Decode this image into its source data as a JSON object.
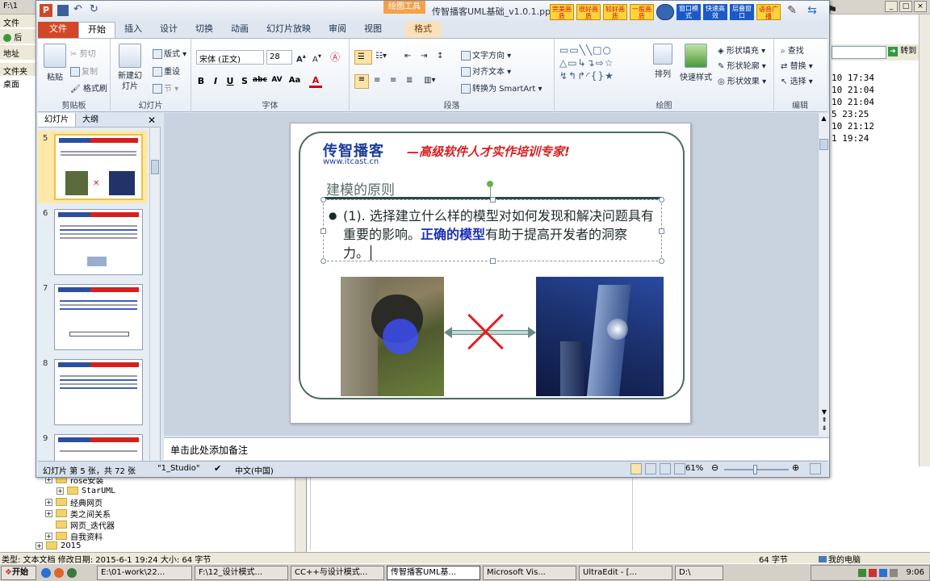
{
  "explorer": {
    "title_fragment": "F:\\1",
    "menu_file": "文件",
    "back": "后",
    "address_label": "地址",
    "folders_label": "文件夹",
    "desktop": "桌面",
    "go_label": "转到",
    "times": [
      "10 17:34",
      "10 21:04",
      "10 21:04",
      "5 23:25",
      "10 21:12",
      "1 19:24"
    ],
    "tree": [
      {
        "label": "rose安装",
        "indent": 2
      },
      {
        "label": "StarUML",
        "indent": 2
      },
      {
        "label": "经典网页",
        "indent": 1
      },
      {
        "label": "类之间关系",
        "indent": 1
      },
      {
        "label": "网页_迭代器",
        "indent": 1
      },
      {
        "label": "自我资料",
        "indent": 1
      },
      {
        "label": "2015",
        "indent": 0
      }
    ],
    "status_left": "类型: 文本文档 修改日期: 2015-6-1 19:24 大小: 64 字节",
    "status_mid": "64 字节",
    "status_right": "我的电脑"
  },
  "taskbar": {
    "start": "开始",
    "tasks": [
      "E:\\01-work\\22...",
      "F:\\12_设计模式...",
      "CC++与设计模式...",
      "传智播客UML基...",
      "Microsoft Vis...",
      "UltraEdit - [...",
      "D:\\"
    ],
    "active_index": 3,
    "clock": "9:06"
  },
  "ppt": {
    "title": "传智播客UML基础_v1.0.1.pp",
    "context_tool": "绘图工具",
    "context_tab": "格式",
    "qat_buttons": [
      "完美画质",
      "很好画质",
      "较好画质",
      "一般画质",
      "窗口模式",
      "快速高效",
      "层叠窗口",
      "语音广播"
    ],
    "tabs": [
      "文件",
      "开始",
      "插入",
      "设计",
      "切换",
      "动画",
      "幻灯片放映",
      "审阅",
      "视图"
    ],
    "selected_tab": "开始",
    "ribbon": {
      "clipboard": {
        "label": "剪贴板",
        "paste": "粘贴",
        "cut": "剪切",
        "copy": "复制",
        "format_painter": "格式刷"
      },
      "slides": {
        "label": "幻灯片",
        "new_slide": "新建幻灯片",
        "layout": "版式",
        "reset": "重设",
        "section": "节"
      },
      "font": {
        "label": "字体",
        "font_name": "宋体 (正文)",
        "font_size": "28"
      },
      "paragraph": {
        "label": "段落",
        "text_direction": "文字方向",
        "align_text": "对齐文本",
        "smartart": "转换为 SmartArt"
      },
      "drawing": {
        "label": "绘图",
        "arrange": "排列",
        "quick_styles": "快速样式",
        "shape_fill": "形状填充",
        "shape_outline": "形状轮廓",
        "shape_effects": "形状效果"
      },
      "editing": {
        "label": "编辑",
        "find": "查找",
        "replace": "替换",
        "select": "选择"
      }
    },
    "pane_tabs": [
      "幻灯片",
      "大纲"
    ],
    "thumbnails": [
      5,
      6,
      7,
      8,
      9
    ],
    "selected_thumbnail": 5,
    "slide": {
      "logo_cn": "传智播客",
      "logo_url": "www.itcast.cn",
      "slogan": "—高级软件人才实作培训专家!",
      "heading": "建模的原则",
      "bullet_part1": "(1). 选择建立什么样的模型对如何发现和解决问题具有重要的影响。",
      "bullet_highlight": "正确的模型",
      "bullet_part2": "有助于提高开发者的洞察力。"
    },
    "notes_placeholder": "单击此处添加备注",
    "status": {
      "slide_info": "幻灯片 第 5 张，共 72 张",
      "theme": "\"1_Studio\"",
      "language": "中文(中国)",
      "zoom": "61%"
    }
  },
  "colors": {
    "file_tab": "#d24726",
    "slogan": "#d6201e",
    "highlight": "#1a2fb8",
    "frame": "#4c6b63"
  }
}
